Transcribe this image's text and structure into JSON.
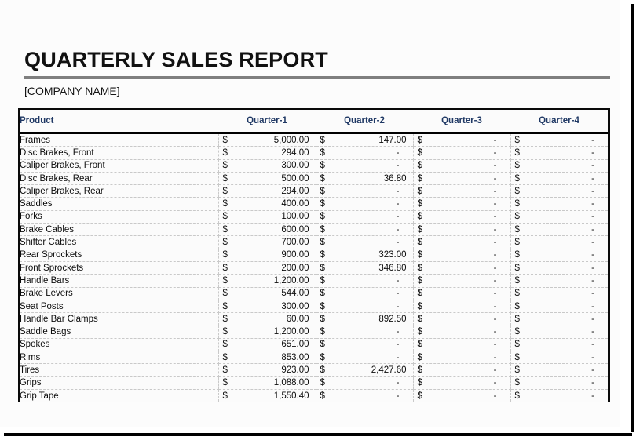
{
  "document": {
    "title": "QUARTERLY SALES REPORT",
    "company_placeholder": "[COMPANY NAME]",
    "rule_color": "#7f7f7f",
    "header_text_color": "#1f3864",
    "currency_symbol": "$",
    "empty_value": "-"
  },
  "table": {
    "headers": [
      "Product",
      "Quarter-1",
      "Quarter-2",
      "Quarter-3",
      "Quarter-4"
    ],
    "rows": [
      {
        "product": "Frames",
        "q1": "5,000.00",
        "q2": "147.00",
        "q3": "-",
        "q4": "-"
      },
      {
        "product": "Disc Brakes, Front",
        "q1": "294.00",
        "q2": "-",
        "q3": "-",
        "q4": "-"
      },
      {
        "product": "Caliper Brakes, Front",
        "q1": "300.00",
        "q2": "-",
        "q3": "-",
        "q4": "-"
      },
      {
        "product": "Disc Brakes, Rear",
        "q1": "500.00",
        "q2": "36.80",
        "q3": "-",
        "q4": "-"
      },
      {
        "product": "Caliper Brakes, Rear",
        "q1": "294.00",
        "q2": "-",
        "q3": "-",
        "q4": "-"
      },
      {
        "product": "Saddles",
        "q1": "400.00",
        "q2": "-",
        "q3": "-",
        "q4": "-"
      },
      {
        "product": "Forks",
        "q1": "100.00",
        "q2": "-",
        "q3": "-",
        "q4": "-"
      },
      {
        "product": "Brake Cables",
        "q1": "600.00",
        "q2": "-",
        "q3": "-",
        "q4": "-"
      },
      {
        "product": "Shifter Cables",
        "q1": "700.00",
        "q2": "-",
        "q3": "-",
        "q4": "-"
      },
      {
        "product": "Rear Sprockets",
        "q1": "900.00",
        "q2": "323.00",
        "q3": "-",
        "q4": "-"
      },
      {
        "product": "Front Sprockets",
        "q1": "200.00",
        "q2": "346.80",
        "q3": "-",
        "q4": "-"
      },
      {
        "product": "Handle Bars",
        "q1": "1,200.00",
        "q2": "-",
        "q3": "-",
        "q4": "-"
      },
      {
        "product": "Brake Levers",
        "q1": "544.00",
        "q2": "-",
        "q3": "-",
        "q4": "-"
      },
      {
        "product": "Seat Posts",
        "q1": "300.00",
        "q2": "-",
        "q3": "-",
        "q4": "-"
      },
      {
        "product": "Handle Bar Clamps",
        "q1": "60.00",
        "q2": "892.50",
        "q3": "-",
        "q4": "-"
      },
      {
        "product": "Saddle Bags",
        "q1": "1,200.00",
        "q2": "-",
        "q3": "-",
        "q4": "-"
      },
      {
        "product": "Spokes",
        "q1": "651.00",
        "q2": "-",
        "q3": "-",
        "q4": "-"
      },
      {
        "product": "Rims",
        "q1": "853.00",
        "q2": "-",
        "q3": "-",
        "q4": "-"
      },
      {
        "product": "Tires",
        "q1": "923.00",
        "q2": "2,427.60",
        "q3": "-",
        "q4": "-"
      },
      {
        "product": "Grips",
        "q1": "1,088.00",
        "q2": "-",
        "q3": "-",
        "q4": "-"
      },
      {
        "product": "Grip Tape",
        "q1": "1,550.40",
        "q2": "-",
        "q3": "-",
        "q4": "-"
      }
    ]
  }
}
